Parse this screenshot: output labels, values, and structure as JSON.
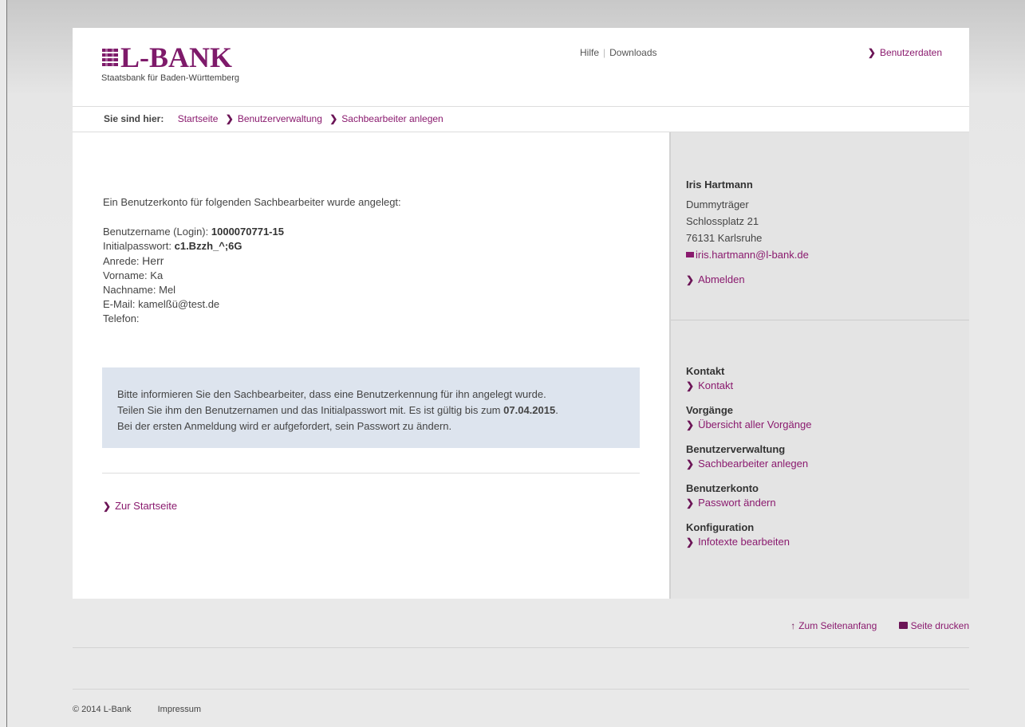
{
  "header": {
    "logo_text": "L-BANK",
    "logo_subtitle": "Staatsbank für Baden-Württemberg",
    "nav": [
      "Hilfe",
      "Downloads"
    ],
    "userdata": "Benutzerdaten"
  },
  "breadcrumb": {
    "label": "Sie sind hier:",
    "items": [
      "Startseite",
      "Benutzerverwaltung",
      "Sachbearbeiter anlegen"
    ]
  },
  "main": {
    "intro": "Ein Benutzerkonto für folgenden Sachbearbeiter wurde angelegt:",
    "fields": {
      "username_label": "Benutzername (Login):",
      "username_value": "1000070771-15",
      "password_label": "Initialpasswort:",
      "password_value": "c1.Bzzh_^;6G",
      "salutation_label": "Anrede:",
      "salutation_value": "Herr",
      "firstname_label": "Vorname:",
      "firstname_value": "Ka",
      "lastname_label": "Nachname:",
      "lastname_value": "Mel",
      "email_label": "E-Mail:",
      "email_value": "kamelßü@test.de",
      "phone_label": "Telefon:",
      "phone_value": ""
    },
    "info_line1": "Bitte informieren Sie den Sachbearbeiter, dass eine Benutzerkennung für ihn angelegt wurde.",
    "info_line2_prefix": "Teilen Sie ihm den Benutzernamen und das Initialpasswort mit. Es ist gültig bis zum",
    "info_date": "07.04.2015",
    "info_line3": "Bei der ersten Anmeldung wird er aufgefordert, sein Passwort zu ändern.",
    "back_link": "Zur Startseite"
  },
  "sidebar": {
    "user": {
      "name": "Iris Hartmann",
      "org": "Dummyträger",
      "street": "Schlossplatz 21",
      "city": "76131 Karlsruhe",
      "email": "iris.hartmann@l-bank.de",
      "logout": "Abmelden"
    },
    "menu": [
      {
        "head": "Kontakt",
        "item": "Kontakt"
      },
      {
        "head": "Vorgänge",
        "item": "Übersicht aller Vorgänge"
      },
      {
        "head": "Benutzerverwaltung",
        "item": "Sachbearbeiter anlegen"
      },
      {
        "head": "Benutzerkonto",
        "item": "Passwort ändern"
      },
      {
        "head": "Konfiguration",
        "item": "Infotexte bearbeiten"
      }
    ]
  },
  "footer": {
    "to_top": "Zum Seitenanfang",
    "print": "Seite drucken",
    "copyright": "© 2014 L-Bank",
    "imprint": "Impressum"
  },
  "colors": {
    "brand": "#7e1a6a",
    "link": "#8a1a6e",
    "info_bg": "#dde4ee",
    "sidebar_bg": "#e4e4e4"
  }
}
